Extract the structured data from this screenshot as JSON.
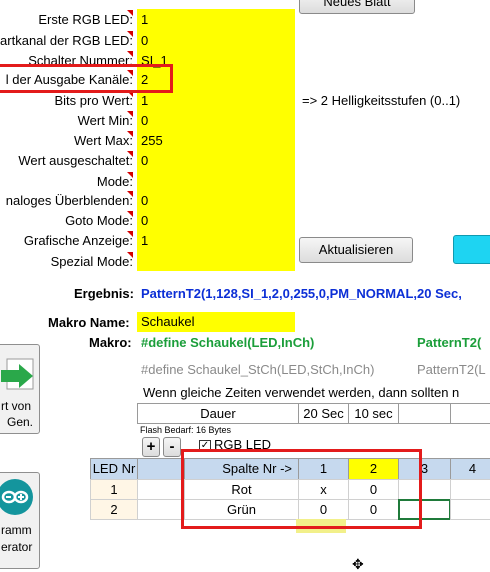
{
  "top_button": "Neues Blatt",
  "params": [
    {
      "label": "Erste RGB LED:",
      "value": "1"
    },
    {
      "label": "artkanal der RGB LED:",
      "value": "0"
    },
    {
      "label": "Schalter Nummer:",
      "value": "SI_1"
    },
    {
      "label": "l der Ausgabe Kanäle:",
      "value": "2"
    },
    {
      "label": "Bits pro Wert:",
      "value": "1"
    },
    {
      "label": "Wert Min:",
      "value": "0"
    },
    {
      "label": "Wert Max:",
      "value": "255"
    },
    {
      "label": "Wert ausgeschaltet:",
      "value": "0"
    },
    {
      "label": "Mode:",
      "value": ""
    },
    {
      "label": "naloges Überblenden:",
      "value": "0"
    },
    {
      "label": "Goto Mode:",
      "value": "0"
    },
    {
      "label": "Grafische Anzeige:",
      "value": "1"
    },
    {
      "label": "Spezial Mode:",
      "value": ""
    }
  ],
  "bits_note": "=> 2 Helligkeitsstufen (0..1)",
  "update_button": "Aktualisieren",
  "result_label": "Ergebnis:",
  "result_value": "PatternT2(1,128,SI_1,2,0,255,0,PM_NORMAL,20 Sec,",
  "macro_name_label": "Makro Name:",
  "macro_name_value": "Schaukel",
  "macro_label": "Makro:",
  "macro_define": "#define Schaukel(LED,InCh)",
  "macro_pattern": "PatternT2(",
  "macro_define2": "#define Schaukel_StCh(LED,StCh,InCh)",
  "macro_pattern2": "PatternT2(L",
  "warning": "Wenn gleiche Zeiten verwendet werden, dann sollten n",
  "duration_label": "Dauer",
  "durations": [
    "20 Sec",
    "10 sec"
  ],
  "flash_label": "Flash Bedarf:  16 Bytes",
  "plus": "+",
  "minus": "-",
  "rgb_checkbox_label": "RGB LED",
  "table_led_header": "LED Nr",
  "table_col_header": "Spalte Nr  ->",
  "table_cols": [
    "1",
    "2",
    "3",
    "4"
  ],
  "table_rows": [
    {
      "led": "1",
      "name": "Rot",
      "values": [
        "x",
        "0"
      ]
    },
    {
      "led": "2",
      "name": "Grün",
      "values": [
        "0",
        "0"
      ]
    }
  ],
  "side_btn1_text": [
    "rt von",
    "Gen."
  ],
  "side_btn2_text": [
    "ramm",
    "erator"
  ],
  "colors": {
    "field_yellow": "#ffff00",
    "accent_red": "#e31b1b",
    "result_blue": "#0c2fd6",
    "macro_green": "#1b9e3a",
    "header_blue": "#c6d9ee",
    "cyan_button": "#1ed4f2"
  }
}
